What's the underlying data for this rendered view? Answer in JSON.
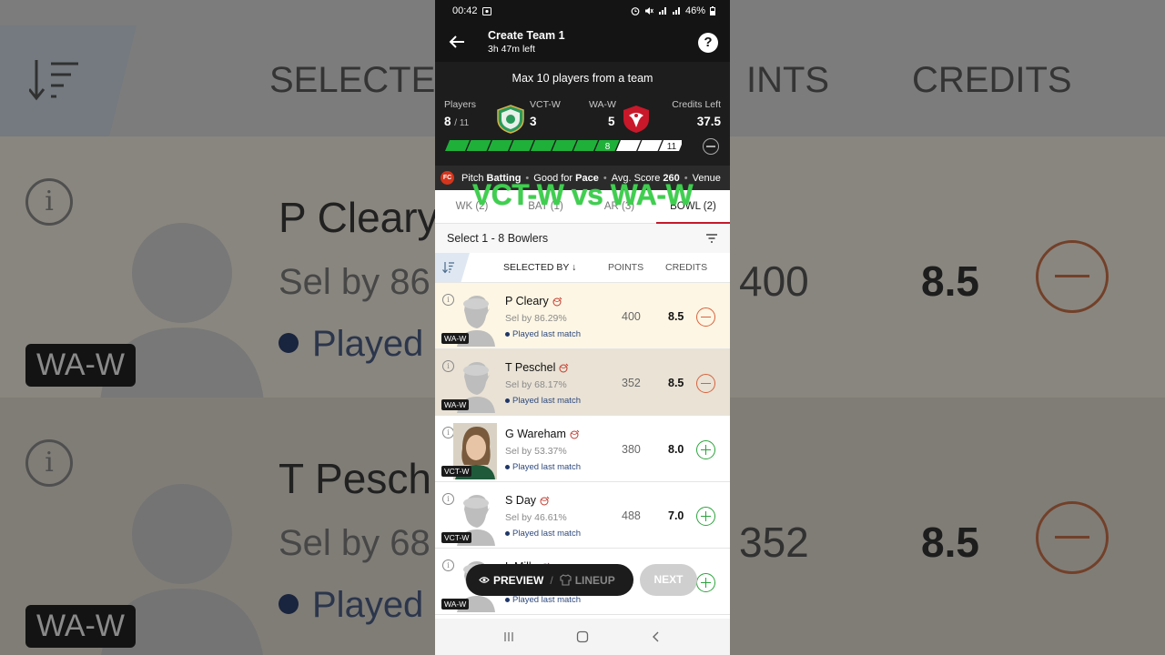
{
  "status": {
    "time": "00:42",
    "battery": "46%"
  },
  "topbar": {
    "title": "Create Team 1",
    "subtitle": "3h 47m left",
    "help": "?"
  },
  "header": {
    "max_players": "Max 10 players from a team",
    "players_label": "Players",
    "players_count": "8",
    "players_total": "/ 11",
    "team1_name": "VCT-W",
    "team1_count": "3",
    "team2_name": "WA-W",
    "team2_count": "5",
    "credits_label": "Credits Left",
    "credits_value": "37.5",
    "progress_selected": 8,
    "progress_total": 11,
    "progress_selected_label": "8",
    "progress_total_label": "11"
  },
  "pitch": {
    "pitch_label": "Pitch",
    "pitch_value": "Batting",
    "good_label": "Good for",
    "good_value": "Pace",
    "avg_label": "Avg. Score",
    "avg_value": "260",
    "venue_label": "Venue"
  },
  "overlay_title": "VCT-W vs WA-W",
  "tabs": [
    {
      "label": "WK (2)"
    },
    {
      "label": "BAT (1)"
    },
    {
      "label": "AR (3)"
    },
    {
      "label": "BOWL (2)"
    }
  ],
  "select_bar": {
    "label": "Select 1 - 8 Bowlers"
  },
  "columns": {
    "selected_by": "SELECTED BY ↓",
    "points": "POINTS",
    "credits": "CREDITS"
  },
  "players": [
    {
      "name": "P Cleary",
      "sel": "Sel by 86.29%",
      "played": "Played last match",
      "points": "400",
      "credits": "8.5",
      "team": "WA-W",
      "selected": true
    },
    {
      "name": "T Peschel",
      "sel": "Sel by 68.17%",
      "played": "Played last match",
      "points": "352",
      "credits": "8.5",
      "team": "WA-W",
      "selected": true
    },
    {
      "name": "G Wareham",
      "sel": "Sel by 53.37%",
      "played": "Played last match",
      "points": "380",
      "credits": "8.0",
      "team": "VCT-W",
      "selected": false
    },
    {
      "name": "S Day",
      "sel": "Sel by 46.61%",
      "played": "Played last match",
      "points": "488",
      "credits": "7.0",
      "team": "VCT-W",
      "selected": false
    },
    {
      "name": "L Mills",
      "sel": "",
      "played": "Played last match",
      "points": "",
      "credits": "",
      "team": "WA-W",
      "selected": false
    }
  ],
  "floating": {
    "preview": "PREVIEW",
    "lineup": "LINEUP",
    "next": "NEXT"
  },
  "background": {
    "selected_head": "SELECTE",
    "points_head": "INTS",
    "credits_head": "CREDITS",
    "row1_name": "P Cleary",
    "row1_sel": "Sel by 86",
    "row1_played": "Played la",
    "row1_points": "400",
    "row1_credits": "8.5",
    "row1_badge": "WA-W",
    "row2_name": "T Pesch",
    "row2_sel": "Sel by 68",
    "row2_played": "Played la",
    "row2_points": "352",
    "row2_credits": "8.5",
    "row2_badge": "WA-W"
  },
  "colors": {
    "accent_red": "#c41a2c",
    "progress_green": "#1fb03a",
    "plus_green": "#2aa33a",
    "minus_orange": "#d9623c",
    "overlay_green": "#3fcf4f"
  }
}
